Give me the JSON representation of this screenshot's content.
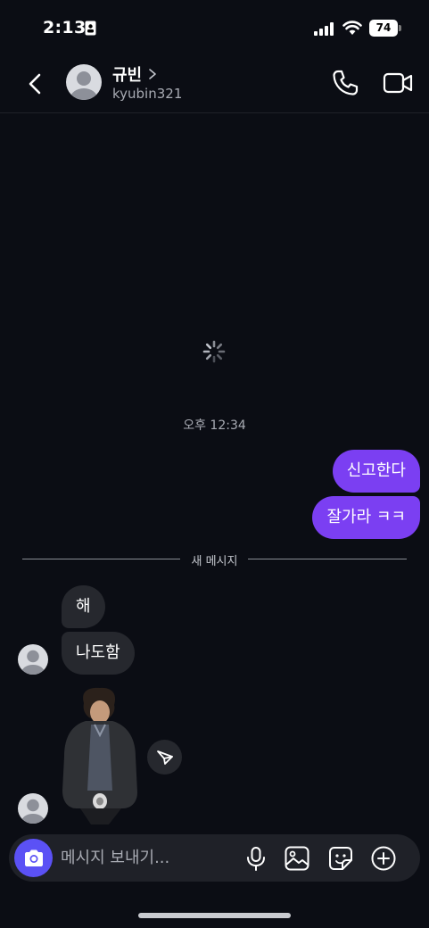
{
  "status_bar": {
    "time": "2:13",
    "battery": "74",
    "icons": [
      "id-card-icon",
      "signal-icon",
      "wifi-icon",
      "battery-icon"
    ]
  },
  "header": {
    "name": "규빈",
    "username": "kyubin321",
    "icons": [
      "back-chevron-icon",
      "avatar-placeholder-icon",
      "chevron-right-icon",
      "phone-icon",
      "video-camera-icon"
    ]
  },
  "conversation": {
    "timestamp": "오후 12:34",
    "outgoing": [
      {
        "text": "신고한다"
      },
      {
        "text": "잘가라 ㅋㅋ"
      }
    ],
    "new_message_divider": "새 메시지",
    "incoming": [
      {
        "text": "해"
      },
      {
        "text": "나도함"
      }
    ],
    "sticker_icon": "person-sticker-icon",
    "share_icon": "send-icon"
  },
  "composer": {
    "placeholder": "메시지 보내기...",
    "icons": [
      "camera-icon",
      "microphone-icon",
      "gallery-icon",
      "sticker-icon",
      "plus-circle-icon"
    ]
  },
  "colors": {
    "background": "#0b0d14",
    "outgoing_bubble": "#7b3ff2",
    "incoming_bubble": "#26282e",
    "camera_button": "#5b51f5"
  }
}
